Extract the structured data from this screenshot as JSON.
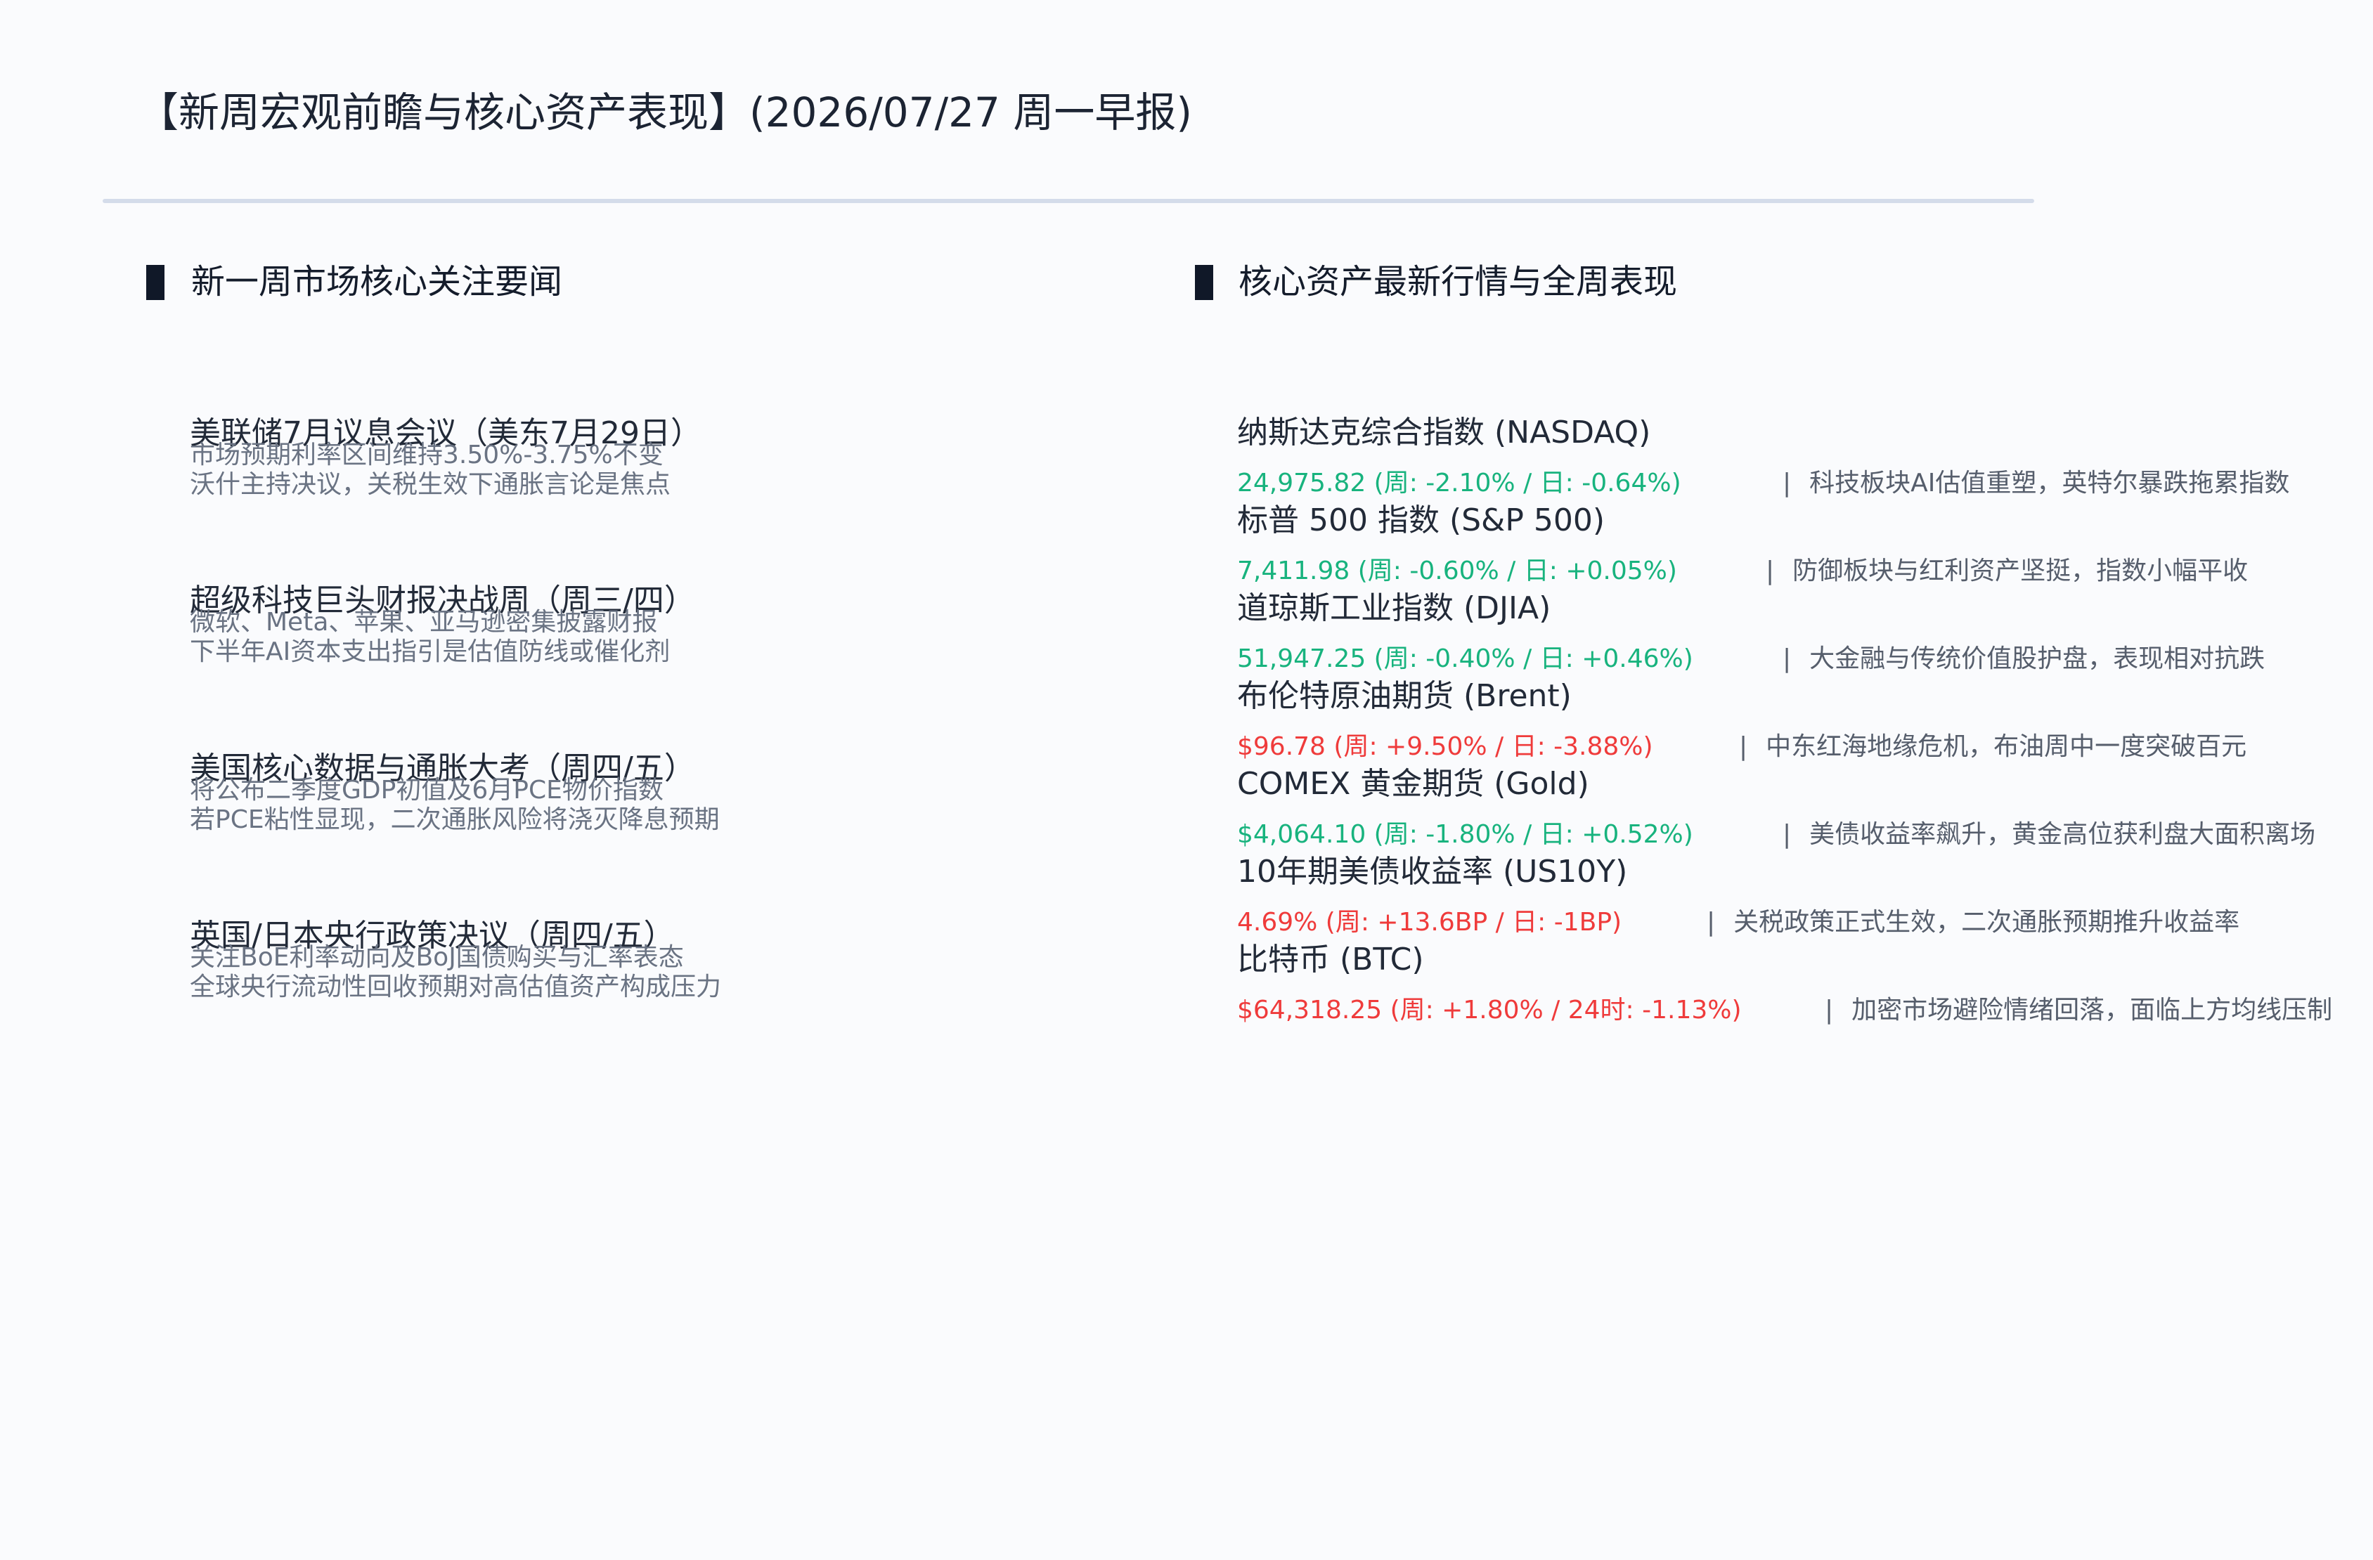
{
  "title": "【新周宏观前瞻与核心资产表现】(2026/07/27 周一早报)",
  "left_section": {
    "heading": "新一周市场核心关注要闻",
    "items": [
      {
        "title": "美联储7月议息会议（美东7月29日）",
        "line1": "市场预期利率区间维持3.50%-3.75%不变",
        "line2": "沃什主持决议，关税生效下通胀言论是焦点"
      },
      {
        "title": "超级科技巨头财报决战周（周三/四）",
        "line1": "微软、Meta、苹果、亚马逊密集披露财报",
        "line2": "下半年AI资本支出指引是估值防线或催化剂"
      },
      {
        "title": "美国核心数据与通胀大考（周四/五）",
        "line1": "将公布二季度GDP初值及6月PCE物价指数",
        "line2": "若PCE粘性显现，二次通胀风险将浇灭降息预期"
      },
      {
        "title": "英国/日本央行政策决议（周四/五）",
        "line1": "关注BoE利率动向及BoJ国债购买与汇率表态",
        "line2": "全球央行流动性回收预期对高估值资产构成压力"
      }
    ]
  },
  "right_section": {
    "heading": "核心资产最新行情与全周表现",
    "assets": [
      {
        "name": "纳斯达克综合指数 (NASDAQ)",
        "quote": "24,975.82 (周: -2.10% / 日: -0.64%)",
        "direction": "down",
        "separator": "|",
        "note": "科技板块AI估值重塑，英特尔暴跌拖累指数"
      },
      {
        "name": "标普 500 指数 (S&P 500)",
        "quote": "7,411.98 (周: -0.60% / 日: +0.05%)",
        "direction": "down",
        "separator": "|",
        "note": "防御板块与红利资产坚挺，指数小幅平收"
      },
      {
        "name": "道琼斯工业指数 (DJIA)",
        "quote": "51,947.25 (周: -0.40% / 日: +0.46%)",
        "direction": "down",
        "separator": "|",
        "note": "大金融与传统价值股护盘，表现相对抗跌"
      },
      {
        "name": "布伦特原油期货 (Brent)",
        "quote": "$96.78 (周: +9.50% / 日: -3.88%)",
        "direction": "up",
        "separator": "|",
        "note": "中东红海地缘危机，布油周中一度突破百元"
      },
      {
        "name": "COMEX 黄金期货 (Gold)",
        "quote": "$4,064.10 (周: -1.80% / 日: +0.52%)",
        "direction": "down",
        "separator": "|",
        "note": "美债收益率飙升，黄金高位获利盘大面积离场"
      },
      {
        "name": "10年期美债收益率 (US10Y)",
        "quote": "4.69% (周: +13.6BP / 日: -1BP)",
        "direction": "up",
        "separator": "|",
        "note": "关税政策正式生效，二次通胀预期推升收益率"
      },
      {
        "name": "比特币 (BTC)",
        "quote": "$64,318.25 (周: +1.80% / 24时: -1.13%)",
        "direction": "up",
        "separator": "|",
        "note": "加密市场避险情绪回落，面临上方均线压制"
      }
    ]
  },
  "colors": {
    "down": "#18b37e",
    "up": "#ef3b3b",
    "rule": "#d4dcea",
    "marker": "#101828"
  }
}
